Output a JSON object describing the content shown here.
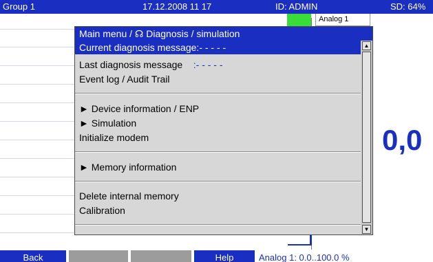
{
  "titlebar": {
    "group": "Group 1",
    "datetime": "17.12.2008 11 17",
    "user": "ID: ADMIN",
    "sd": "SD: 64%"
  },
  "background": {
    "analog_tab": "Analog 1",
    "big_value": "0,0"
  },
  "menu": {
    "title": "Main menu / ☊ Diagnosis / simulation",
    "items": [
      {
        "label": "Current diagnosis message:",
        "value": "- - - - -",
        "selected": true
      },
      {
        "label": "Last diagnosis message",
        "value": ":- - - - -"
      },
      {
        "label": "Event log / Audit Trail"
      },
      {
        "label": "► Device information / ENP"
      },
      {
        "label": "► Simulation"
      },
      {
        "label": "Initialize modem"
      },
      {
        "label": "► Memory information"
      },
      {
        "label": "Delete internal memory"
      },
      {
        "label": "Calibration"
      }
    ]
  },
  "keys": {
    "back": "Back",
    "key2": "",
    "key3": "",
    "help": "Help"
  },
  "status": "Analog 1: 0.0..100.0 %",
  "colors": {
    "accent": "#1a2fc2",
    "menu_bg": "#d7d7d7",
    "key_gray": "#9c9c9c",
    "green": "#3adc3a"
  }
}
